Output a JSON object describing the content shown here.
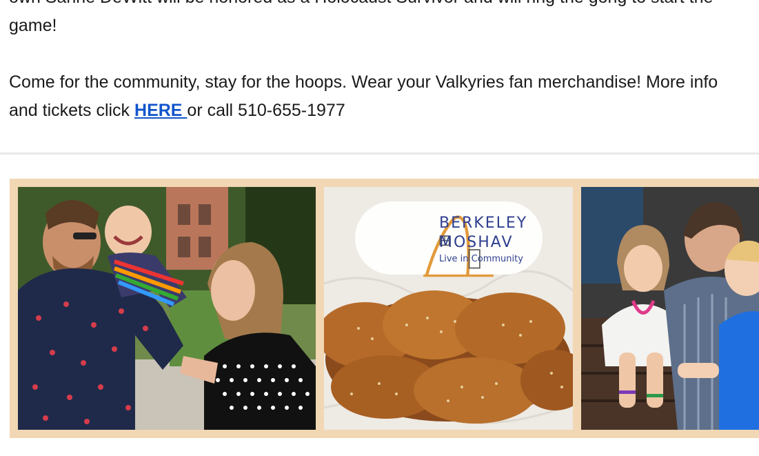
{
  "content": {
    "para1_line1": "own Sanne DeWitt will be honored as a Holocaust Survivor and will ring the gong to start the",
    "para1_line2": "game!",
    "para2_line1": "Come for the community, stay for the hoops. Wear your Valkyries fan merchandise! More info",
    "para2_before_link": "and tickets click ",
    "para2_link": "HERE ",
    "para2_after_link": "or call 510-655-1977"
  },
  "banner": {
    "logo_line1": "BERKELEY",
    "logo_line2": "MOSHAV",
    "logo_tagline": "Live in Community",
    "panels": [
      "family-photo",
      "challah-photo",
      "children-photo"
    ]
  },
  "colors": {
    "link": "#1155cc",
    "banner_frame": "#f1d7b4",
    "logo_text": "#2f3f8f",
    "logo_orange": "#e29a3a"
  }
}
